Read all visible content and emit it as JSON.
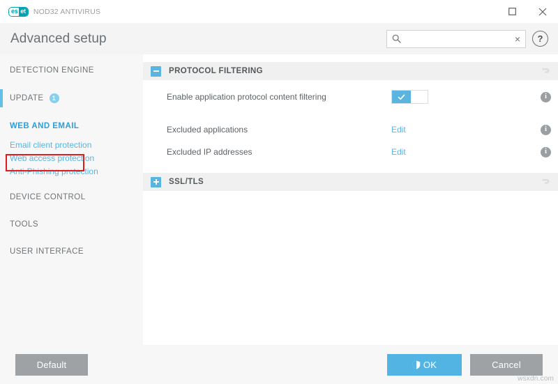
{
  "window": {
    "brand_es": "es",
    "brand_et": "et",
    "product_name": "NOD32 ANTIVIRUS",
    "controls": [
      {
        "name": "maximize-button",
        "label": "Maximize"
      },
      {
        "name": "close-button",
        "label": "Close"
      }
    ]
  },
  "header": {
    "title": "Advanced setup",
    "search": {
      "value": "",
      "placeholder": "",
      "icon": "search-icon",
      "clear_label": "×"
    },
    "help_label": "?"
  },
  "sidebar": {
    "items": [
      {
        "label": "DETECTION ENGINE",
        "name": "detection-engine",
        "selected": false,
        "badge": null,
        "accent": false
      },
      {
        "label": "UPDATE",
        "name": "update",
        "selected": false,
        "badge": "1",
        "accent": true
      },
      {
        "label": "WEB AND EMAIL",
        "name": "web-and-email",
        "selected": true,
        "badge": null,
        "accent": false
      },
      {
        "label": "DEVICE CONTROL",
        "name": "device-control",
        "selected": false,
        "badge": null,
        "accent": false
      },
      {
        "label": "TOOLS",
        "name": "tools",
        "selected": false,
        "badge": null,
        "accent": false
      },
      {
        "label": "USER INTERFACE",
        "name": "user-interface",
        "selected": false,
        "badge": null,
        "accent": false
      }
    ],
    "sub_items": [
      {
        "label": "Email client protection",
        "name": "email-client-protection"
      },
      {
        "label": "Web access protection",
        "name": "web-access-protection"
      },
      {
        "label": "Anti-Phishing protection",
        "name": "anti-phishing-protection"
      }
    ],
    "highlight_color": "#e01b1b"
  },
  "content": {
    "sections": [
      {
        "title": "PROTOCOL FILTERING",
        "name": "protocol-filtering",
        "expanded": true,
        "expander_icon": "minus-icon",
        "reset_icon": "reset-icon"
      },
      {
        "title": "SSL/TLS",
        "name": "ssl-tls",
        "expanded": false,
        "expander_icon": "plus-icon",
        "reset_icon": "reset-icon"
      }
    ],
    "rows": [
      {
        "label": "Enable application protocol content filtering",
        "name": "enable-application-protocol-content-filtering",
        "control": "toggle",
        "value": "on",
        "info": "i"
      },
      {
        "label": "Excluded applications",
        "name": "excluded-applications",
        "control": "link",
        "value": "Edit",
        "info": "i"
      },
      {
        "label": "Excluded IP addresses",
        "name": "excluded-ip-addresses",
        "control": "link",
        "value": "Edit",
        "info": "i"
      }
    ]
  },
  "footer": {
    "default_label": "Default",
    "ok_label": "OK",
    "ok_icon": "shield-icon",
    "cancel_label": "Cancel"
  },
  "watermark": "wsxdn.com",
  "colors": {
    "accent_blue": "#52b4e3",
    "link_blue": "#56b6e4",
    "brand_teal": "#00a5b5",
    "highlight_red": "#e01b1b",
    "gray_button": "#9ea2a5"
  }
}
